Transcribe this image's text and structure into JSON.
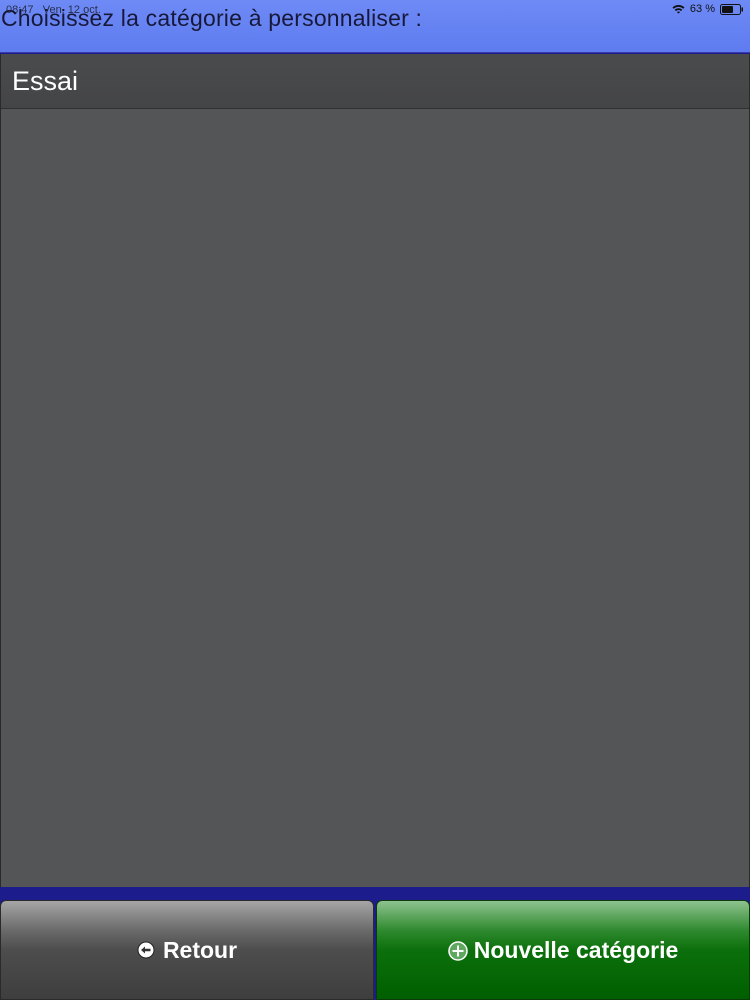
{
  "status_bar": {
    "time": "08:47",
    "date": "Ven. 12 oct.",
    "battery": "63 %",
    "wifi_icon": "wifi-icon",
    "battery_icon": "battery-icon"
  },
  "header": {
    "title": "Choisissez la catégorie à personnaliser :"
  },
  "list": {
    "items": [
      {
        "label": "Essai"
      }
    ]
  },
  "buttons": {
    "back": {
      "label": "Retour",
      "icon": "back-arrow-icon"
    },
    "new_category": {
      "label": "Nouvelle catégorie",
      "icon": "plus-circle-icon"
    }
  },
  "colors": {
    "header_bg": "#6e8af5",
    "panel_bg": "#545557",
    "back_button": "#4d4d4d",
    "new_button": "#0b700b",
    "page_bg": "#1c1c8c"
  }
}
